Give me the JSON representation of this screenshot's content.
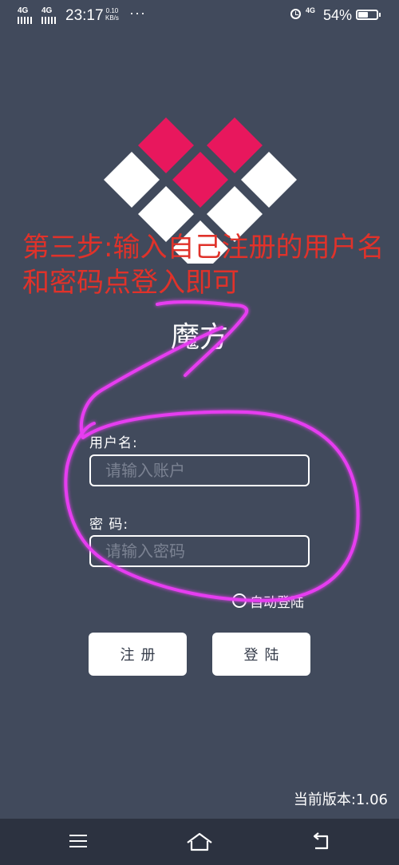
{
  "status_bar": {
    "network_1": "4G",
    "network_2": "4G",
    "time": "23:17",
    "speed_value": "0.10",
    "speed_unit": "KB/s",
    "more": "···",
    "network_right": "4G",
    "battery_percent": "54%",
    "battery_level": 0.54
  },
  "annotation": {
    "text": "第三步:输入自己注册的用户名和密码点登入即可",
    "color": "#e0322a"
  },
  "app": {
    "name": "魔方",
    "logo_colors": {
      "accent": "#e8175d",
      "light": "#ffffff"
    }
  },
  "login_form": {
    "username_label": "用户名:",
    "username_placeholder": "请输入账户",
    "username_value": "",
    "password_label": "密 码:",
    "password_placeholder": "请输入密码",
    "password_value": "",
    "auto_login_label": "自动登陆",
    "auto_login_checked": false,
    "register_button": "注册",
    "login_button": "登陆"
  },
  "footer": {
    "version": "当前版本:1.06"
  },
  "nav_bar": {
    "menu_icon": "menu-icon",
    "home_icon": "home-icon",
    "back_icon": "back-icon"
  },
  "colors": {
    "background": "#414a5c",
    "nav_background": "#2c3240",
    "highlight_stroke": "#e63cf0"
  }
}
